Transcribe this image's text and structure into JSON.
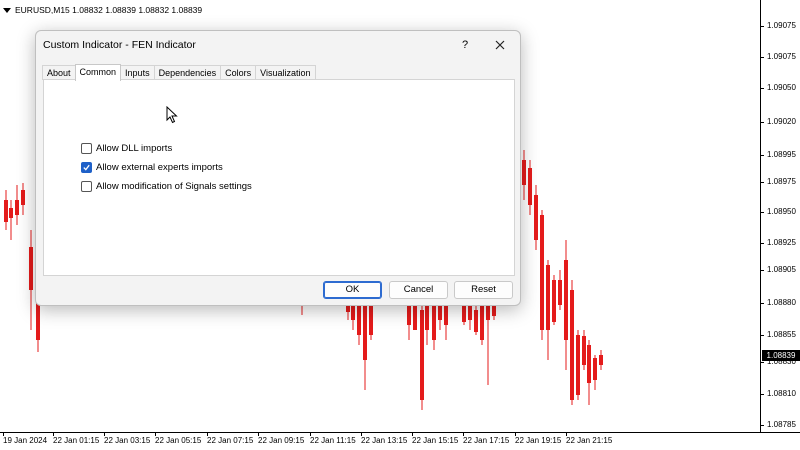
{
  "chart": {
    "symbol_info": "EURUSD,M15  1.08832 1.08839 1.08832 1.08839",
    "bull_color": "#20a020",
    "bear_color": "#e41b1b",
    "price_labels": [
      "1.09075",
      "1.09050",
      "1.09020",
      "1.08995",
      "1.08975",
      "1.08950",
      "1.08925",
      "1.08905",
      "1.08880",
      "1.08855",
      "1.08830",
      "1.08810",
      "1.08785"
    ],
    "current_price": "1.08839",
    "time_labels": [
      "19 Jan 2024",
      "22 Jan 01:15",
      "22 Jan 03:15",
      "22 Jan 05:15",
      "22 Jan 07:15",
      "22 Jan 09:15",
      "22 Jan 11:15",
      "22 Jan 13:15",
      "22 Jan 15:15",
      "22 Jan 17:15",
      "22 Jan 19:15",
      "22 Jan 21:15"
    ],
    "top_right_price": "1.09075"
  },
  "dialog": {
    "title": "Custom Indicator - FEN Indicator",
    "help_label": "?",
    "tabs": [
      {
        "label": "About",
        "active": false
      },
      {
        "label": "Common",
        "active": true
      },
      {
        "label": "Inputs",
        "active": false
      },
      {
        "label": "Dependencies",
        "active": false
      },
      {
        "label": "Colors",
        "active": false
      },
      {
        "label": "Visualization",
        "active": false
      }
    ],
    "options": [
      {
        "label": "Allow DLL imports",
        "checked": false
      },
      {
        "label": "Allow external experts imports",
        "checked": true
      },
      {
        "label": "Allow modification of Signals settings",
        "checked": false
      }
    ],
    "buttons": {
      "ok": "OK",
      "cancel": "Cancel",
      "reset": "Reset"
    },
    "accent_color": "#1e60c8"
  }
}
